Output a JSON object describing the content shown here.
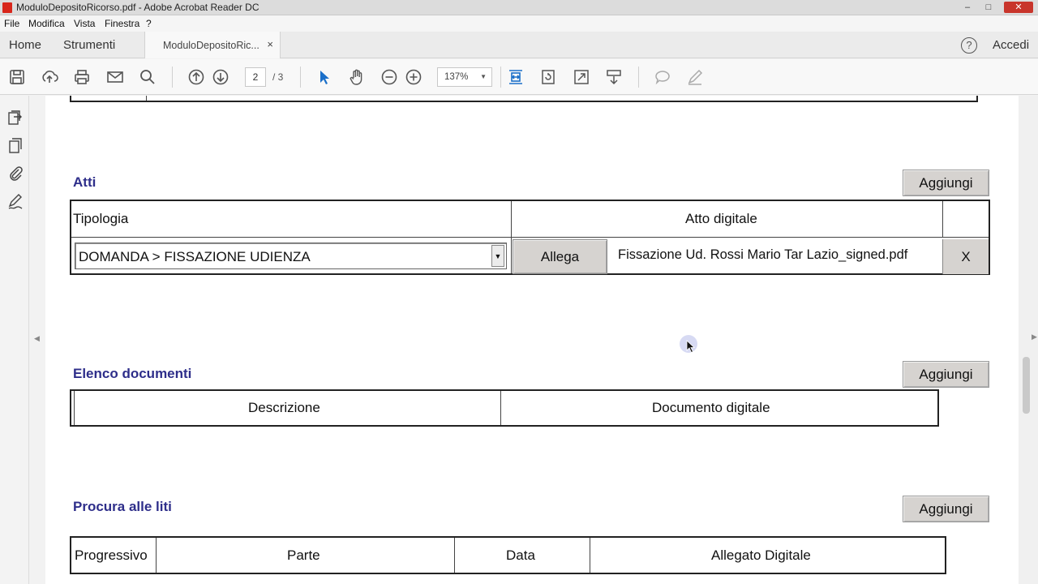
{
  "window": {
    "title": "ModuloDepositoRicorso.pdf - Adobe Acrobat Reader DC",
    "controls": [
      "–",
      "□",
      "✕"
    ]
  },
  "menu": [
    "File",
    "Modifica",
    "Vista",
    "Finestra",
    "?"
  ],
  "tabs": {
    "home": "Home",
    "tools": "Strumenti",
    "document": "ModuloDepositoRic...",
    "close": "×",
    "help": "?",
    "signin": "Accedi"
  },
  "toolbar": {
    "page_current": "2",
    "page_total": "/ 3",
    "zoom": "137%",
    "icons": [
      "save-icon",
      "upload-icon",
      "print-icon",
      "mail-icon",
      "search-icon",
      "prev-page-icon",
      "next-page-icon",
      "select-cursor-icon",
      "hand-icon",
      "zoom-out-icon",
      "zoom-in-icon",
      "fit-width-icon",
      "rotate-icon",
      "fullscreen-icon",
      "scroll-mode-icon",
      "comment-icon",
      "draw-icon"
    ]
  },
  "leftrail": {
    "icons": [
      "export-pdf-icon",
      "copy-pages-icon",
      "attachment-icon",
      "sign-icon"
    ]
  },
  "document": {
    "atti": {
      "title": "Atti",
      "add_button": "Aggiungi",
      "header_type": "Tipologia",
      "header_digital": "Atto digitale",
      "type_value": "DOMANDA > FISSAZIONE UDIENZA",
      "attach_button": "Allega",
      "file_name": "Fissazione Ud. Rossi Mario Tar Lazio_signed.pdf",
      "remove_button": "X"
    },
    "elenco": {
      "title": "Elenco documenti",
      "add_button": "Aggiungi",
      "header_description": "Descrizione",
      "header_digital": "Documento digitale"
    },
    "procura": {
      "title": "Procura alle liti",
      "add_button": "Aggiungi",
      "header_progressive": "Progressivo",
      "header_party": "Parte",
      "header_date": "Data",
      "header_attachment": "Allegato Digitale"
    }
  },
  "colors": {
    "section_title": "#2e2e8a",
    "button_bg": "#d6d3d0",
    "acrobat_red": "#d8261b"
  }
}
